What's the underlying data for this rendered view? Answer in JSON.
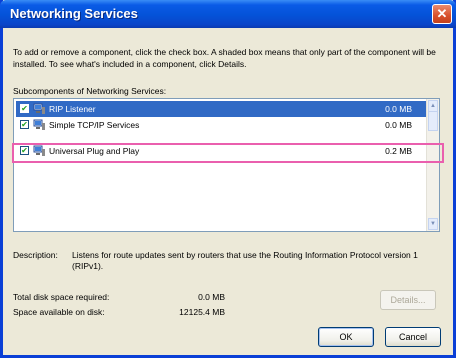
{
  "window": {
    "title": "Networking Services",
    "close_symbol": "✕"
  },
  "instructions": "To add or remove a component, click the check box. A shaded box means that only part of the component will be installed. To see what's included in a component, click Details.",
  "subcomponents_label": "Subcomponents of Networking Services:",
  "components": [
    {
      "label": "RIP Listener",
      "size": "0.0 MB",
      "checked": true,
      "selected": true,
      "icon": "network-component-icon"
    },
    {
      "label": "Simple TCP/IP Services",
      "size": "0.0 MB",
      "checked": true,
      "selected": false,
      "icon": "network-component-icon"
    },
    {
      "label": "Universal Plug and Play",
      "size": "0.2 MB",
      "checked": true,
      "selected": false,
      "icon": "network-component-icon"
    }
  ],
  "description": {
    "label": "Description:",
    "text": "Listens for route updates sent by routers that use the Routing Information Protocol version 1 (RIPv1)."
  },
  "disk": {
    "required_label": "Total disk space required:",
    "required_value": "0.0 MB",
    "available_label": "Space available on disk:",
    "available_value": "12125.4 MB"
  },
  "buttons": {
    "details": "Details...",
    "ok": "OK",
    "cancel": "Cancel"
  },
  "colors": {
    "title_bar": "#0452d8",
    "selection": "#316ac5",
    "highlight_box": "#ea5fae"
  }
}
